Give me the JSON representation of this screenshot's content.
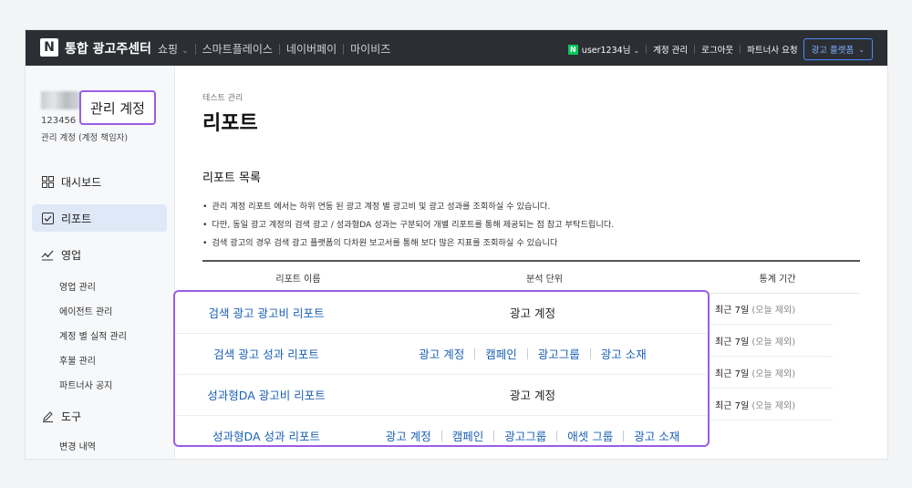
{
  "topbar": {
    "logo": "N",
    "brand": "통합 광고주센터",
    "nav": [
      {
        "label": "쇼핑",
        "has_dropdown": true
      },
      {
        "label": "스마트플레이스",
        "has_dropdown": false
      },
      {
        "label": "네이버페이",
        "has_dropdown": false
      },
      {
        "label": "마이비즈",
        "has_dropdown": false
      }
    ],
    "user": "user1234님",
    "account_manage": "계정 관리",
    "logout": "로그아웃",
    "partner_request": "파트너사 요청",
    "platform_button": "광고 플랫폼"
  },
  "sidebar": {
    "account_id": "123456",
    "account_role": "관리 계정 (계정 책임자)",
    "callout": "관리 계정",
    "menu": [
      {
        "key": "dashboard",
        "label": "대시보드",
        "icon": "dashboard-icon"
      },
      {
        "key": "report",
        "label": "리포트",
        "icon": "report-check-icon",
        "active": true
      },
      {
        "key": "sales",
        "label": "영업",
        "icon": "chart-line-icon"
      }
    ],
    "sales_sub": [
      "영업 관리",
      "에이전트 관리",
      "계정 별 실적 관리",
      "후불 관리",
      "파트너사 공지"
    ],
    "tools": {
      "label": "도구",
      "icon": "pencil-icon"
    },
    "tools_sub": [
      "변경 내역"
    ]
  },
  "main": {
    "breadcrumb": "테스트 관리",
    "title": "리포트",
    "section_title": "리포트 목록",
    "notes": [
      "관리 계정 리포트 에서는 하위 연동 된 광고 계정 별 광고비 및 광고 성과를 조회하실 수 있습니다.",
      "다만, 동일 광고 계정의 검색 광고 / 성과형DA 성과는 구분되어 개별 리포트를 통해 제공되는 점 참고 부탁드립니다.",
      "검색 광고의 경우 검색 광고 플랫폼의 다차원 보고서를 통해  보다 많은 지표를 조회하실 수 있습니다"
    ],
    "table": {
      "headers": [
        "리포트 이름",
        "분석 단위",
        "통계 기간"
      ],
      "rows": [
        {
          "name": "검색 광고 광고비 리포트",
          "units": [
            "광고 계정"
          ],
          "units_linked": false,
          "period": "최근 7일",
          "period_note": "(오늘 제외)"
        },
        {
          "name": "검색 광고 성과 리포트",
          "units": [
            "광고 계정",
            "캠페인",
            "광고그룹",
            "광고 소재"
          ],
          "units_linked": true,
          "period": "최근 7일",
          "period_note": "(오늘 제외)"
        },
        {
          "name": "성과형DA 광고비 리포트",
          "units": [
            "광고 계정"
          ],
          "units_linked": false,
          "period": "최근 7일",
          "period_note": "(오늘 제외)"
        },
        {
          "name": "성과형DA 성과 리포트",
          "units": [
            "광고 계정",
            "캠페인",
            "광고그룹",
            "애셋 그룹",
            "광고 소재"
          ],
          "units_linked": true,
          "period": "최근 7일",
          "period_note": "(오늘 제외)"
        }
      ]
    }
  },
  "colors": {
    "topbar_bg": "#2b2e33",
    "link": "#1a5fb4",
    "highlight": "#9b5de5",
    "active_menu_bg": "#dfe8f7",
    "naver_green": "#03c75a"
  }
}
